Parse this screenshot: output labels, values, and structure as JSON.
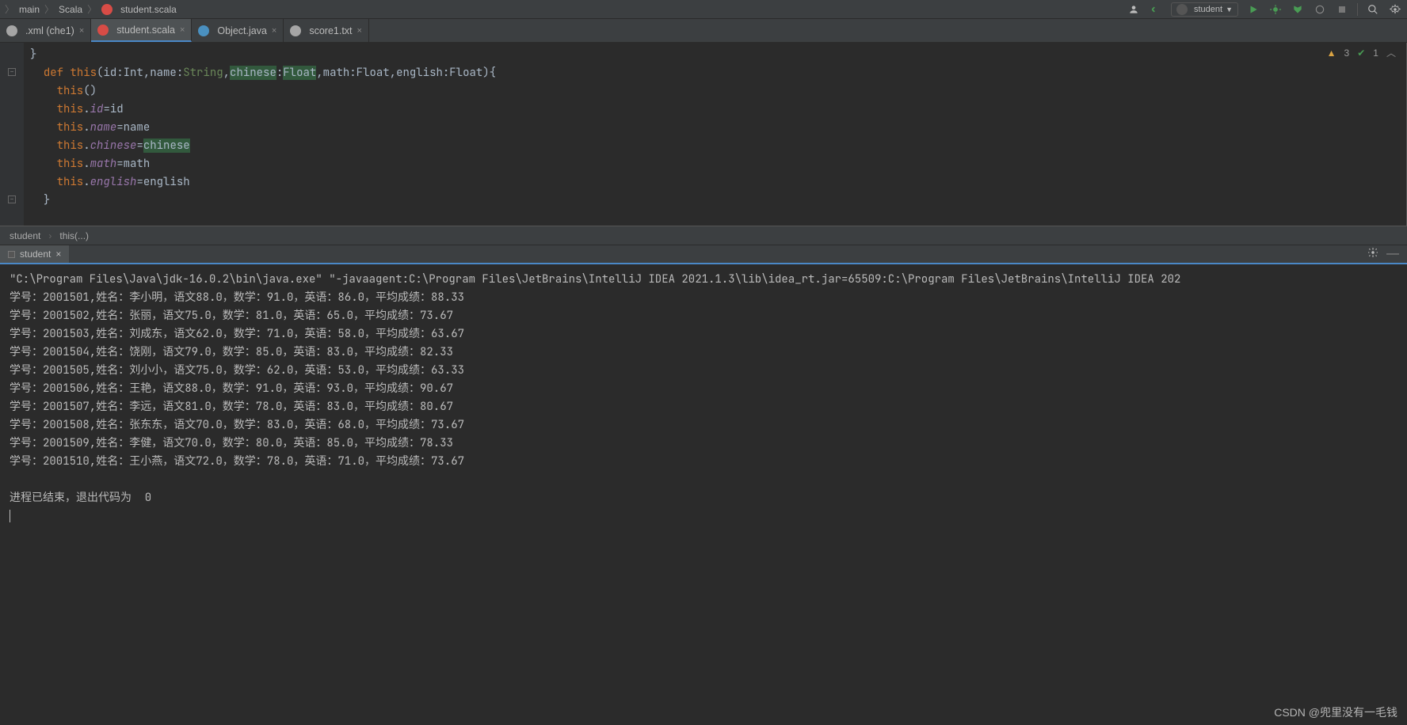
{
  "nav": {
    "crumbs": [
      "main",
      "Scala",
      "student.scala"
    ],
    "runConfig": "student",
    "warnings": "3",
    "checks": "1"
  },
  "tabs": [
    {
      "label": ".xml (che1)",
      "icon": "txt",
      "active": false
    },
    {
      "label": "student.scala",
      "icon": "scala",
      "active": true
    },
    {
      "label": "Object.java",
      "icon": "java",
      "active": false
    },
    {
      "label": "score1.txt",
      "icon": "txt",
      "active": false
    }
  ],
  "code": {
    "l1": "}",
    "def": "def",
    "thiskw": "this",
    "sig_open": "(id:Int,name:",
    "sig_str": "String",
    "sig_mid1": ",",
    "sig_chinese_p": "chinese",
    "sig_mid1b": ":",
    "sig_float1": "Float",
    "sig_mid2": ",math:",
    "sig_float2": "Float",
    "sig_mid3": ",english:",
    "sig_float3": "Float",
    "sig_close": "){",
    "l3": "this()",
    "l4a": "this.",
    "l4b": "id",
    "l4c": "=id",
    "l5a": "this.",
    "l5b": "name",
    "l5c": "=name",
    "l6a": "this.",
    "l6b": "chinese",
    "l6c": "=",
    "l6d": "chinese",
    "l7a": "this.",
    "l7b": "math",
    "l7c": "=math",
    "l8a": "this.",
    "l8b": "english",
    "l8c": "=english",
    "l9": "}"
  },
  "subcrumb": {
    "a": "student",
    "b": "this(...)"
  },
  "run": {
    "tabLabel": "student",
    "cmd": "\"C:\\Program Files\\Java\\jdk-16.0.2\\bin\\java.exe\" \"-javaagent:C:\\Program Files\\JetBrains\\IntelliJ IDEA 2021.1.3\\lib\\idea_rt.jar=65509:C:\\Program Files\\JetBrains\\IntelliJ IDEA 202",
    "lines": [
      "学号：2001501,姓名：李小明，语文88.0，数学：91.0，英语：86.0，平均成绩：88.33",
      "学号：2001502,姓名：张丽，语文75.0，数学：81.0，英语：65.0，平均成绩：73.67",
      "学号：2001503,姓名：刘成东，语文62.0，数学：71.0，英语：58.0，平均成绩：63.67",
      "学号：2001504,姓名：饶刚，语文79.0，数学：85.0，英语：83.0，平均成绩：82.33",
      "学号：2001505,姓名：刘小小，语文75.0，数学：62.0，英语：53.0，平均成绩：63.33",
      "学号：2001506,姓名：王艳，语文88.0，数学：91.0，英语：93.0，平均成绩：90.67",
      "学号：2001507,姓名：李远，语文81.0，数学：78.0，英语：83.0，平均成绩：80.67",
      "学号：2001508,姓名：张东东，语文70.0，数学：83.0，英语：68.0，平均成绩：73.67",
      "学号：2001509,姓名：李健，语文70.0，数学：80.0，英语：85.0，平均成绩：78.33",
      "学号：2001510,姓名：王小燕，语文72.0，数学：78.0，英语：71.0，平均成绩：73.67"
    ],
    "exit": "进程已结束，退出代码为  0"
  },
  "watermark": "CSDN @兜里没有一毛钱"
}
